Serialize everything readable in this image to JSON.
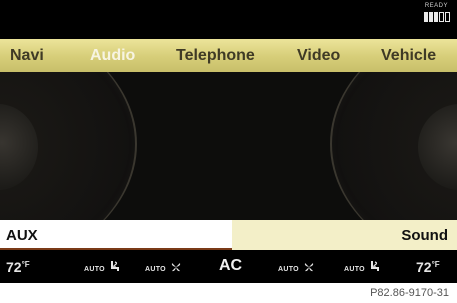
{
  "status": {
    "ready_label": "READY"
  },
  "main_nav": {
    "items": [
      {
        "label": "Navi"
      },
      {
        "label": "Audio"
      },
      {
        "label": "Telephone"
      },
      {
        "label": "Video"
      },
      {
        "label": "Vehicle"
      }
    ],
    "active": "Audio"
  },
  "source_bar": {
    "source_label": "AUX",
    "sound_label": "Sound"
  },
  "climate_bar": {
    "left_temp": "72",
    "left_temp_unit": "°F",
    "left_airflow_auto": "AUTO",
    "left_fan_auto": "AUTO",
    "ac_label": "AC",
    "right_fan_auto": "AUTO",
    "right_airflow_auto": "AUTO",
    "right_temp": "72",
    "right_temp_unit": "°F"
  },
  "figure_ref": "P82.86-9170-31",
  "colors": {
    "nav_bar": "#d6cd78",
    "nav_active_text": "#f7f4e2",
    "sound_bg": "#f3efc8",
    "screen_bg": "#000000"
  },
  "icons": [
    "battery-level-icon",
    "airflow-seat-icon",
    "fan-icon"
  ]
}
